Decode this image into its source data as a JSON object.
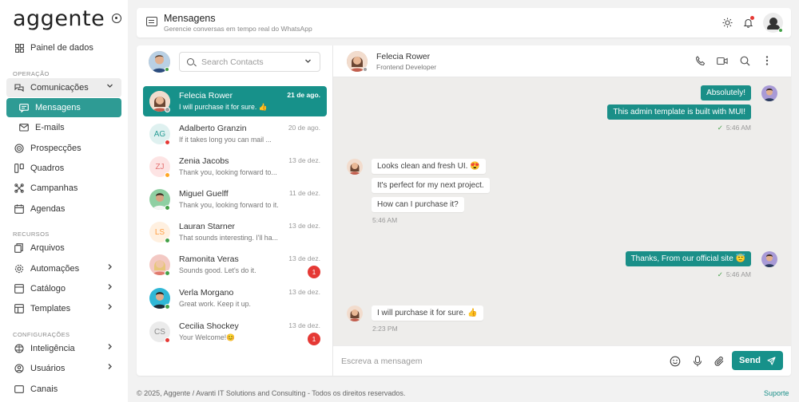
{
  "brand": {
    "logo": "aggente"
  },
  "sidebar": {
    "dashboard": "Painel de dados",
    "section_operation": "OPERAÇÃO",
    "communications": "Comunicações",
    "messages": "Mensagens",
    "emails": "E-mails",
    "prospects": "Prospecções",
    "boards": "Quadros",
    "campaigns": "Campanhas",
    "schedules": "Agendas",
    "section_resources": "RECURSOS",
    "files": "Arquivos",
    "automations": "Automações",
    "catalog": "Catálogo",
    "templates": "Templates",
    "section_settings": "CONFIGURAÇÕES",
    "intelligence": "Inteligência",
    "users": "Usuários",
    "channels": "Canais"
  },
  "header": {
    "title": "Mensagens",
    "subtitle": "Gerencie conversas em tempo real do WhatsApp"
  },
  "search": {
    "placeholder": "Search Contacts"
  },
  "contacts": [
    {
      "name": "Felecia Rower",
      "message": "I will purchase it for sure. 👍",
      "date": "21 de ago.",
      "initials": "",
      "badge": ""
    },
    {
      "name": "Adalberto Granzin",
      "message": "If it takes long you can mail ...",
      "date": "20 de ago.",
      "initials": "AG",
      "badge": ""
    },
    {
      "name": "Zenia Jacobs",
      "message": "Thank you, looking forward to...",
      "date": "13 de dez.",
      "initials": "ZJ",
      "badge": ""
    },
    {
      "name": "Miguel Guelff",
      "message": "Thank you, looking forward to it.",
      "date": "11 de dez.",
      "initials": "",
      "badge": ""
    },
    {
      "name": "Lauran Starner",
      "message": "That sounds interesting. I'll ha...",
      "date": "13 de dez.",
      "initials": "LS",
      "badge": ""
    },
    {
      "name": "Ramonita Veras",
      "message": "Sounds good. Let's do it.",
      "date": "13 de dez.",
      "initials": "",
      "badge": "1"
    },
    {
      "name": "Verla Morgano",
      "message": "Great work. Keep it up.",
      "date": "13 de dez.",
      "initials": "",
      "badge": ""
    },
    {
      "name": "Cecilia Shockey",
      "message": "Your Welcome!😊",
      "date": "13 de dez.",
      "initials": "CS",
      "badge": "1"
    }
  ],
  "chat": {
    "name": "Felecia Rower",
    "role": "Frontend Developer",
    "messages": [
      {
        "text": "Absolutely!",
        "dir": "out"
      },
      {
        "text": "This admin template is built with MUI!",
        "dir": "out"
      },
      {
        "text": "5:46 AM",
        "dir": "meta"
      },
      {
        "text": "Looks clean and fresh UI. 😍",
        "dir": "in"
      },
      {
        "text": "It's perfect for my next project.",
        "dir": "in"
      },
      {
        "text": "How can I purchase it?",
        "dir": "in"
      },
      {
        "text": "5:46 AM",
        "dir": "meta"
      },
      {
        "text": "Thanks, From our official site  😇",
        "dir": "out"
      },
      {
        "text": "5:46 AM",
        "dir": "meta"
      },
      {
        "text": "I will purchase it for sure. 👍",
        "dir": "in"
      },
      {
        "text": "2:23 PM",
        "dir": "meta"
      }
    ]
  },
  "composer": {
    "placeholder": "Escreva a mensagem",
    "send_label": "Send"
  },
  "footer": {
    "copyright": "© 2025, Aggente / Avanti IT Solutions and Consulting - Todos os direitos reservados.",
    "support": "Suporte"
  },
  "colors": {
    "accent": "#17918a",
    "badge": "#e53935",
    "online": "#43a047"
  }
}
